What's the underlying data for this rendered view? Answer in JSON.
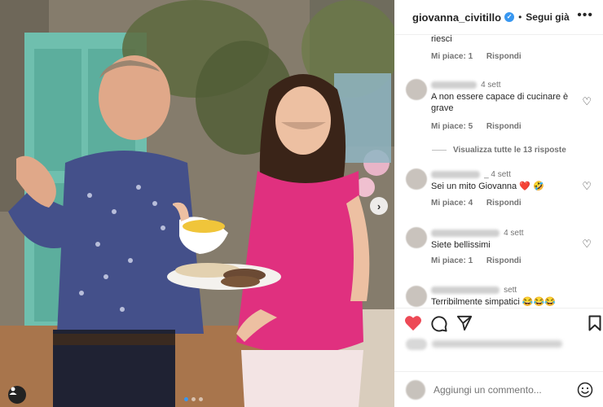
{
  "post": {
    "username": "giovanna_civitillo",
    "follow_label": "Segui già",
    "separator": "•"
  },
  "comments": [
    {
      "text": "riesci",
      "likes": "Mi piace: 1",
      "reply": "Rispondi"
    },
    {
      "time": "4 sett",
      "text": "A non essere capace di cucinare è grave",
      "likes": "Mi piace: 5",
      "reply": "Rispondi"
    },
    {
      "time": "_ 4 sett",
      "text": "Sei un mito Giovanna ❤️ 🤣",
      "likes": "Mi piace: 4",
      "reply": "Rispondi"
    },
    {
      "time": "4 sett",
      "text": "Siete bellissimi",
      "likes": "Mi piace: 1",
      "reply": "Rispondi"
    },
    {
      "time": "sett",
      "text": "Terribilmente simpatici 😂😂😂"
    }
  ],
  "view_replies_label": "Visualizza tutte le 13 risposte",
  "add_comment": {
    "placeholder": "Aggiungi un commento..."
  },
  "colors": {
    "liked_heart": "#ed4956",
    "verified": "#3897f0",
    "top_bg": "#ffffff"
  },
  "icons": {
    "more": "more-options-icon",
    "like": "heart-filled-icon",
    "comment": "comment-bubble-icon",
    "share": "paper-plane-icon",
    "save": "bookmark-icon",
    "emoji": "emoji-smile-icon",
    "next": "chevron-right-icon",
    "tags": "user-tag-icon"
  },
  "carousel": {
    "slide_count": 3,
    "current_slide": 1
  }
}
